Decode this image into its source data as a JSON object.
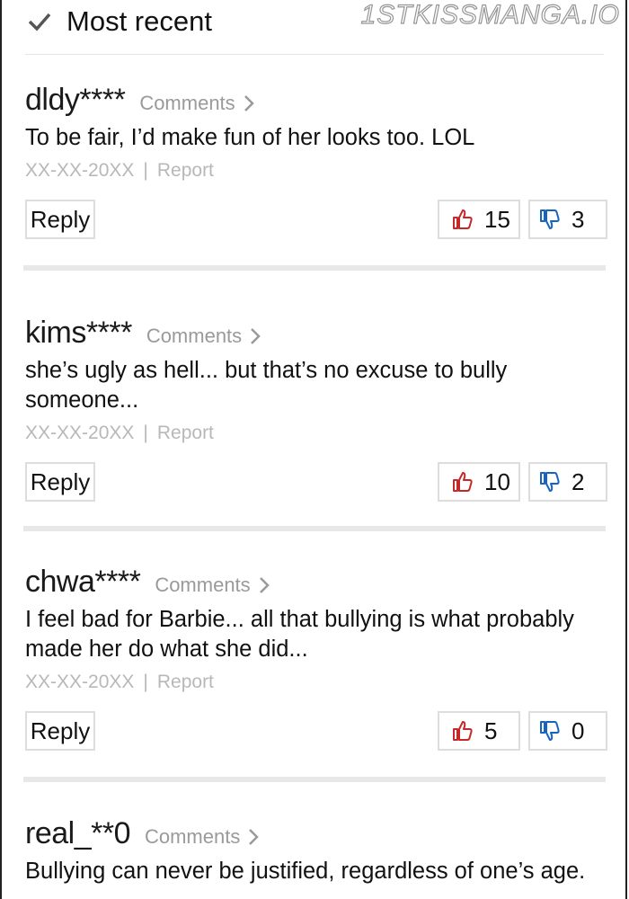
{
  "header": {
    "title": "Most recent",
    "watermark": "1STKISSMANGA.IO"
  },
  "comments": [
    {
      "username": "dldy****",
      "comments_label": "Comments",
      "text": "To be fair, I’d make fun of her looks too. LOL",
      "date": "XX-XX-20XX",
      "report_label": "Report",
      "reply_label": "Reply",
      "likes": "15",
      "dislikes": "3"
    },
    {
      "username": "kims****",
      "comments_label": "Comments",
      "text": "she’s ugly as hell... but that’s no excuse to bully someone...",
      "date": "XX-XX-20XX",
      "report_label": "Report",
      "reply_label": "Reply",
      "likes": "10",
      "dislikes": "2"
    },
    {
      "username": "chwa****",
      "comments_label": "Comments",
      "text": "I feel bad for Barbie... all that bullying is what probably made her do what she did...",
      "date": "XX-XX-20XX",
      "report_label": "Report",
      "reply_label": "Reply",
      "likes": "5",
      "dislikes": "0"
    },
    {
      "username": "real_**0",
      "comments_label": "Comments",
      "text": "Bullying can never be justified, regardless of one’s age."
    }
  ],
  "colors": {
    "like": "#c62828",
    "dislike": "#1565c0",
    "muted": "#9a9a9a"
  }
}
